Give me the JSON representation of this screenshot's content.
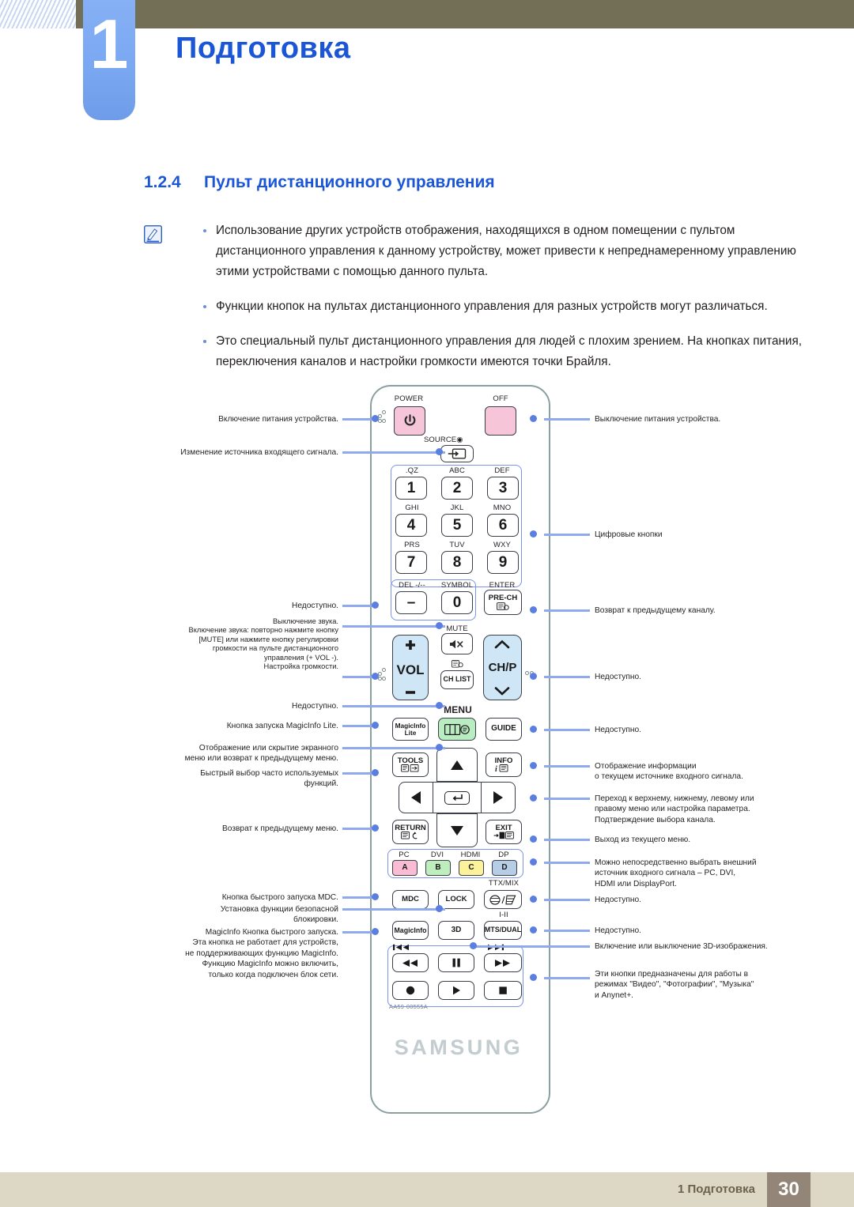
{
  "header": {
    "chapter_number": "1",
    "chapter_title": "Подготовка"
  },
  "section": {
    "number": "1.2.4",
    "title": "Пульт дистанционного управления"
  },
  "notes": [
    "Использование других устройств отображения, находящихся в одном помещении с пультом дистанционного управления к данному устройству, может привести к непреднамеренному управлению этими устройствами с помощью данного пульта.",
    "Функции кнопок на пультах дистанционного управления для разных устройств могут различаться.",
    "Это специальный пульт дистанционного управления для людей с плохим зрением. На кнопках питания, переключения каналов и настройки громкости имеются точки Брайля."
  ],
  "remote": {
    "brand": "SAMSUNG",
    "model_code": "AA59-00555A",
    "captions": {
      "power": "POWER",
      "off": "OFF",
      "source": "SOURCE",
      "qz": ".QZ",
      "abc": "ABC",
      "def": "DEF",
      "ghi": "GHI",
      "jkl": "JKL",
      "mno": "MNO",
      "prs": "PRS",
      "tuv": "TUV",
      "wxy": "WXY",
      "del": "DEL -/--",
      "symbol": "SYMBOL",
      "enter": "ENTER",
      "mute": "MUTE",
      "menu": "MENU",
      "ttxmix": "TTX/MIX",
      "i_ii": "I-II"
    },
    "keys": {
      "dash": "–",
      "zero": "0",
      "one": "1",
      "two": "2",
      "three": "3",
      "four": "4",
      "five": "5",
      "six": "6",
      "seven": "7",
      "eight": "8",
      "nine": "9",
      "prech": "PRE-CH",
      "vol": "VOL",
      "chp": "CH/P",
      "chlist": "CH LIST",
      "magicinfo_lite": "MagicInfo\nLite",
      "guide": "GUIDE",
      "tools": "TOOLS",
      "info": "INFO",
      "return": "RETURN",
      "exit": "EXIT",
      "pc": "PC",
      "dvi": "DVI",
      "hdmi": "HDMI",
      "dp": "DP",
      "a": "A",
      "b": "B",
      "c": "C",
      "d": "D",
      "mdc": "MDC",
      "lock": "LOCK",
      "magicinfo": "MagicInfo",
      "three_d": "3D",
      "mts_dual": "MTS/DUAL"
    },
    "colors": {
      "power_pink": "#f6c6d8",
      "off_pink": "#f6c6d8",
      "vol_blue": "#cfe6f7",
      "chp_blue": "#cfe6f7",
      "menu_green": "#b9ecc0",
      "a_pink": "#f9bcd3",
      "b_green": "#bdeebb",
      "c_yellow": "#fbf29a",
      "d_blue": "#b6cde6",
      "body_outline": "#8aa0a0",
      "group_outline": "#7b93e8",
      "lead_line": "#8fa9ec",
      "lead_dot": "#5b7fe0"
    }
  },
  "annotations_left": [
    {
      "text": "Включение питания устройства."
    },
    {
      "text": "Изменение источника входящего сигнала."
    },
    {
      "text": "Недоступно."
    },
    {
      "text": "Выключение звука.\nВключение звука: повторно нажмите кнопку\n[MUTE]  или нажмите кнопку регулировки\nгромкости на пульте дистанционного\nуправления (+  VOL  -).\nНастройка громкости."
    },
    {
      "text": "Недоступно."
    },
    {
      "text": "Кнопка запуска MagicInfo Lite."
    },
    {
      "text": "Отображение или скрытие экранного\nменю или возврат к предыдущему меню."
    },
    {
      "text": "Быстрый выбор часто используемых\nфункций."
    },
    {
      "text": "Возврат к предыдущему меню."
    },
    {
      "text": "Кнопка быстрого запуска MDC."
    },
    {
      "text": "Установка функции безопасной\nблокировки."
    },
    {
      "text": "MagicInfo Кнопка быстрого запуска.\nЭта кнопка не работает для устройств,\nне поддерживающих функцию MagicInfo.\nФункцию MagicInfo можно включить,\nтолько когда подключен блок сети."
    }
  ],
  "annotations_right": [
    {
      "text": "Выключение питания устройства."
    },
    {
      "text": "Цифровые кнопки"
    },
    {
      "text": "Возврат к предыдущему каналу."
    },
    {
      "text": "Недоступно."
    },
    {
      "text": "Недоступно."
    },
    {
      "text": "Отображение информации\nо текущем источнике входного сигнала."
    },
    {
      "text": "Переход к верхнему, нижнему, левому или\nправому меню или настройка параметра.\nПодтверждение выбора канала."
    },
    {
      "text": "Выход из текущего меню."
    },
    {
      "text": "Можно непосредственно выбрать внешний\nисточник входного сигнала – PC, DVI,\nHDMI или DisplayPort."
    },
    {
      "text": "Недоступно."
    },
    {
      "text": "Недоступно."
    },
    {
      "text": "Включение или выключение 3D-изображения."
    },
    {
      "text": "Эти кнопки предназначены для работы в\nрежимах \"Видео\", \"Фотографии\", \"Музыка\"\nи Anynet+."
    }
  ],
  "footer": {
    "text": "1 Подготовка",
    "page": "30"
  }
}
